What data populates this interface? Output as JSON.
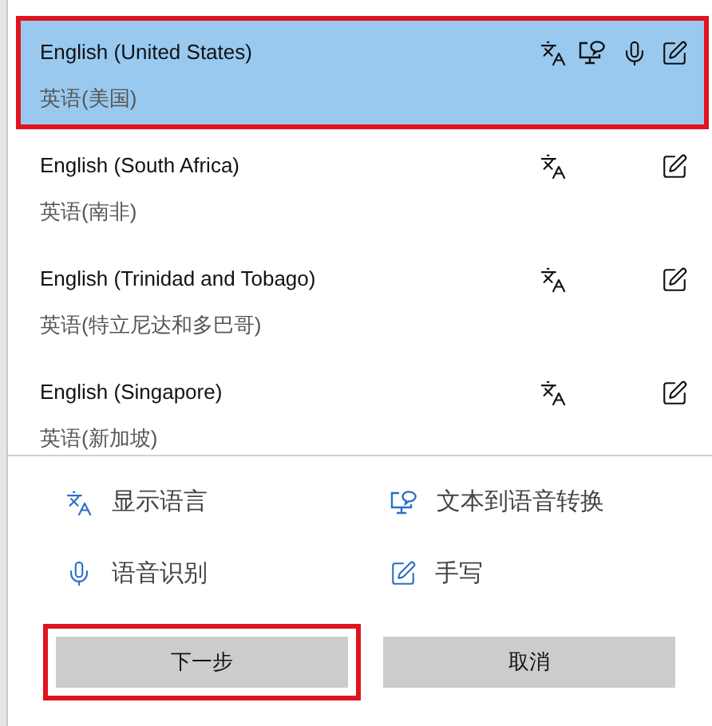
{
  "languages": [
    {
      "name": "English (United States)",
      "native": "英语(美国)",
      "selected": true,
      "marked": true,
      "features": {
        "display": true,
        "tts": true,
        "speech": true,
        "handwriting": true
      }
    },
    {
      "name": "English (South Africa)",
      "native": "英语(南非)",
      "selected": false,
      "marked": false,
      "features": {
        "display": true,
        "tts": false,
        "speech": false,
        "handwriting": true
      }
    },
    {
      "name": "English (Trinidad and Tobago)",
      "native": "英语(特立尼达和多巴哥)",
      "selected": false,
      "marked": false,
      "features": {
        "display": true,
        "tts": false,
        "speech": false,
        "handwriting": true
      }
    },
    {
      "name": "English (Singapore)",
      "native": "英语(新加坡)",
      "selected": false,
      "marked": false,
      "features": {
        "display": true,
        "tts": false,
        "speech": false,
        "handwriting": true
      }
    }
  ],
  "legend": [
    {
      "kind": "display",
      "label": "显示语言"
    },
    {
      "kind": "tts",
      "label": "文本到语音转换"
    },
    {
      "kind": "speech",
      "label": "语音识别"
    },
    {
      "kind": "handwriting",
      "label": "手写"
    }
  ],
  "buttons": [
    {
      "label": "下一步",
      "marked": true
    },
    {
      "label": "取消",
      "marked": false
    }
  ]
}
